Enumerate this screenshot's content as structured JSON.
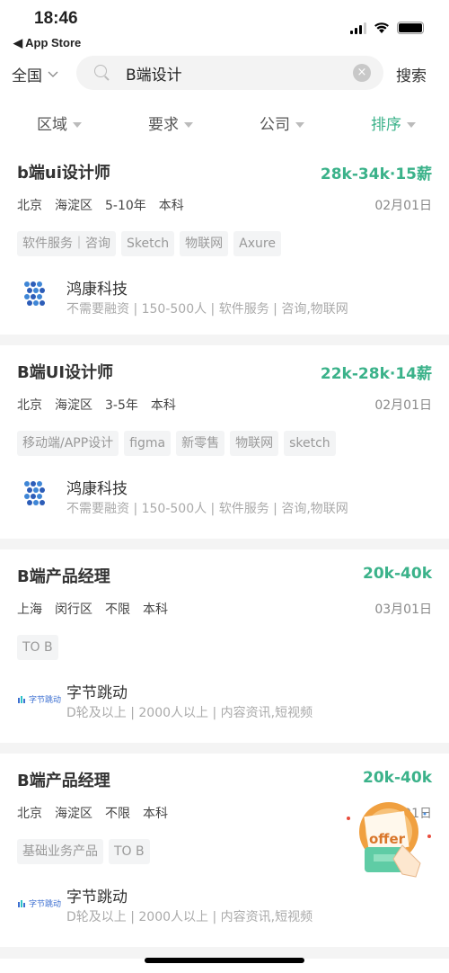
{
  "status_bar": {
    "time": "18:46",
    "back_label": "◀ App Store"
  },
  "header": {
    "region": "全国",
    "search_value": "B端设计",
    "search_button": "搜索",
    "clear_icon": "×"
  },
  "filters": [
    {
      "label": "区域"
    },
    {
      "label": "要求"
    },
    {
      "label": "公司"
    },
    {
      "label": "排序",
      "active": true
    }
  ],
  "colors": {
    "accent": "#3bb28a"
  },
  "jobs": [
    {
      "title": "b端ui设计师",
      "salary": "28k-34k·15薪",
      "city": "北京",
      "district": "海淀区",
      "experience": "5-10年",
      "education": "本科",
      "date": "02月01日",
      "tags": [
        "软件服务｜咨询",
        "Sketch",
        "物联网",
        "Axure"
      ],
      "company": "鸿康科技",
      "company_info": "不需要融资 | 150-500人 | 软件服务 | 咨询,物联网",
      "logo": "honkang-dots"
    },
    {
      "title": "B端UI设计师",
      "salary": "22k-28k·14薪",
      "city": "北京",
      "district": "海淀区",
      "experience": "3-5年",
      "education": "本科",
      "date": "02月01日",
      "tags": [
        "移动端/APP设计",
        "figma",
        "新零售",
        "物联网",
        "sketch"
      ],
      "company": "鸿康科技",
      "company_info": "不需要融资 | 150-500人 | 软件服务 | 咨询,物联网",
      "logo": "honkang-dots"
    },
    {
      "title": "B端产品经理",
      "salary": "20k-40k",
      "city": "上海",
      "district": "闵行区",
      "experience": "不限",
      "education": "本科",
      "date": "03月01日",
      "tags": [
        "TO B"
      ],
      "company": "字节跳动",
      "company_info": "D轮及以上 | 2000人以上 | 内容资讯,短视频",
      "logo": "字节跳动"
    },
    {
      "title": "B端产品经理",
      "salary": "20k-40k",
      "city": "北京",
      "district": "海淀区",
      "experience": "不限",
      "education": "本科",
      "date": "03月01日",
      "tags": [
        "基础业务产品",
        "TO B"
      ],
      "company": "字节跳动",
      "company_info": "D轮及以上 | 2000人以上 | 内容资讯,短视频",
      "logo": "字节跳动"
    }
  ],
  "offer_badge": {
    "text": "offer"
  }
}
